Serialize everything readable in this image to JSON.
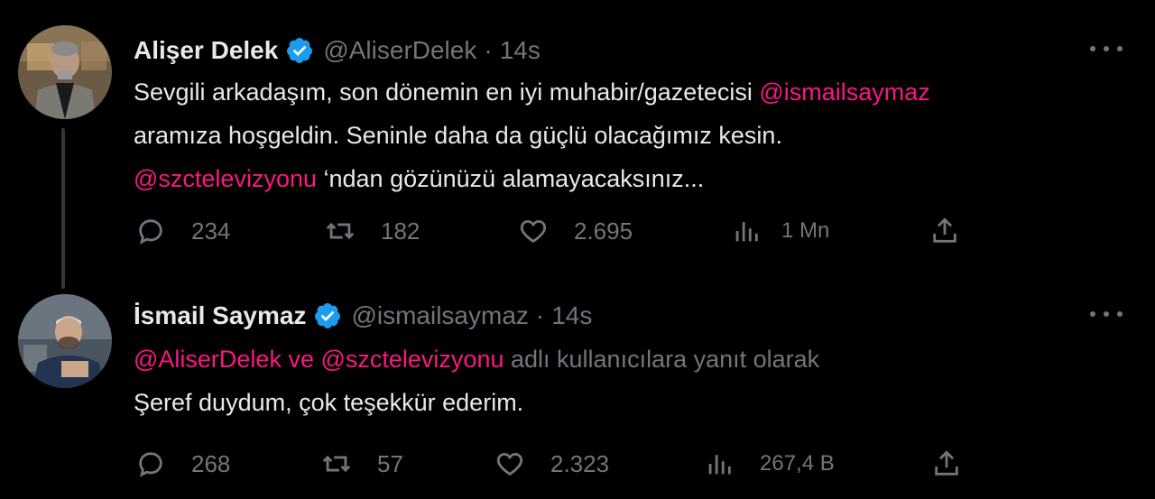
{
  "tweets": [
    {
      "author": {
        "name": "Alişer Delek",
        "handle": "@AliserDelek",
        "verified": true
      },
      "separator": "·",
      "time": "14s",
      "text": {
        "line1_text": "Sevgili arkadaşım, son dönemin en iyi muhabir/gazetecisi ",
        "line1_mention": "@ismailsaymaz",
        "line2_text": "aramıza hoşgeldin. Seninle daha da güçlü olacağımız kesin.",
        "line3_mention": "@szctelevizyonu",
        "line3_text": " ‘ndan gözünüzü alamayacaksınız..."
      },
      "stats": {
        "replies": "234",
        "retweets": "182",
        "likes": "2.695",
        "views": "1 Mn"
      }
    },
    {
      "author": {
        "name": "İsmail Saymaz",
        "handle": "@ismailsaymaz",
        "verified": true
      },
      "separator": "·",
      "time": "14s",
      "reply_context": {
        "mention1": "@AliserDelek",
        "conj": " ve ",
        "mention2": "@szctelevizyonu",
        "suffix": " adlı kullanıcılara yanıt olarak"
      },
      "text": {
        "line1_text": "Şeref duydum, çok teşekkür ederim."
      },
      "stats": {
        "replies": "268",
        "retweets": "57",
        "likes": "2.323",
        "views": "267,4 B"
      }
    }
  ],
  "colors": {
    "background": "#000000",
    "text": "#e7e9ea",
    "muted": "#71767b",
    "mention": "#f91880",
    "verified": "#1d9bf0",
    "thread_line": "#333639"
  },
  "icons": {
    "reply": "reply-icon",
    "retweet": "retweet-icon",
    "like": "heart-icon",
    "views": "views-icon",
    "share": "share-icon",
    "more": "more-icon",
    "verified": "verified-badge-icon"
  }
}
